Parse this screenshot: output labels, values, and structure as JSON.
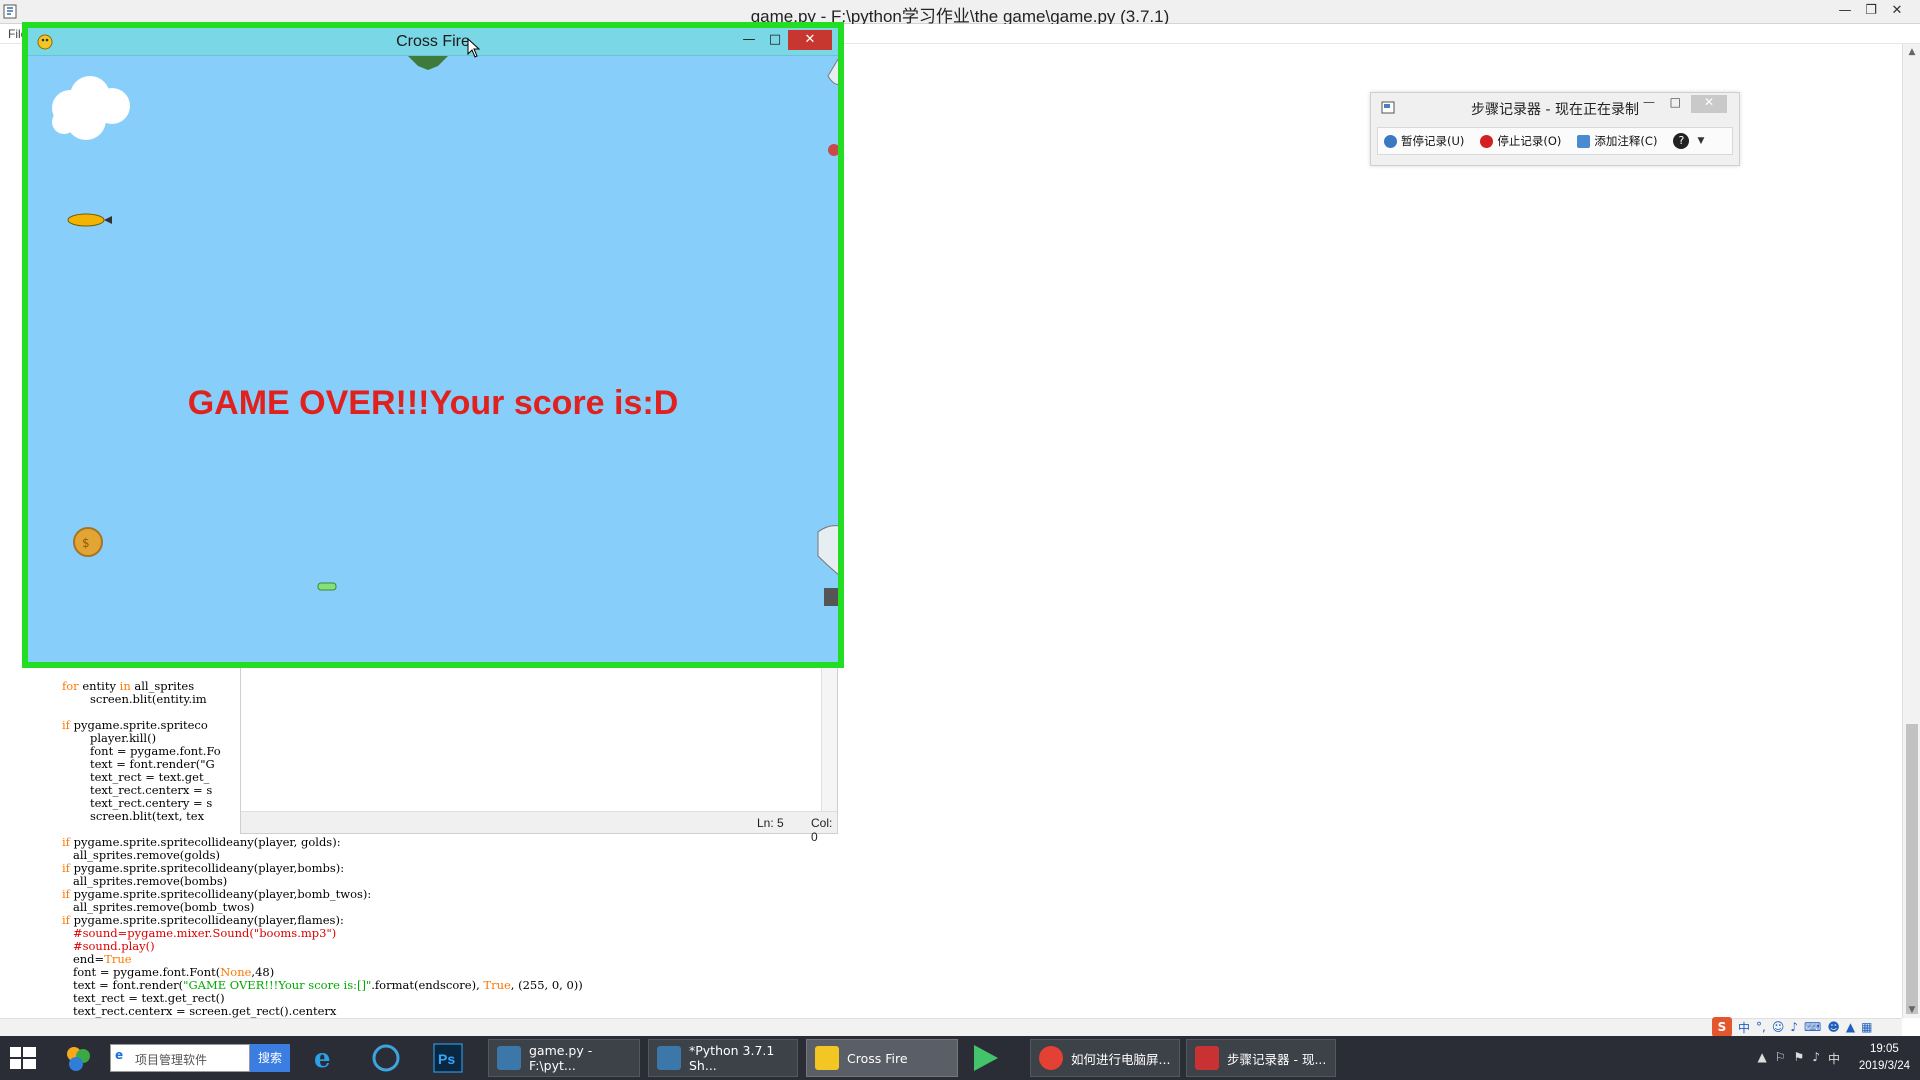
{
  "editor": {
    "title": "game.py - F:\\python学习作业\\the game\\game.py (3.7.1)",
    "menu_file": "File",
    "code_lines_partial": [
      {
        "t": "for entity in all_sprites",
        "indent": 0
      },
      {
        "t": "screen.blit(entity.im",
        "indent": 1
      },
      {
        "t": "",
        "indent": 0
      },
      {
        "t": "if pygame.sprite.spriteco",
        "indent": 0
      },
      {
        "t": "player.kill()",
        "indent": 1
      },
      {
        "t": "font = pygame.font.Fo",
        "indent": 1
      },
      {
        "t": "text = font.render(\"G",
        "indent": 1
      },
      {
        "t": "text_rect = text.get_",
        "indent": 1
      },
      {
        "t": "text_rect.centerx = s",
        "indent": 1
      },
      {
        "t": "text_rect.centery = s",
        "indent": 1
      },
      {
        "t": "screen.blit(text, tex",
        "indent": 1
      }
    ],
    "code_lines_full": [
      "if pygame.sprite.spritecollideany(player, golds):",
      "    all_sprites.remove(golds)",
      "if pygame.sprite.spritecollideany(player,bombs):",
      "    all_sprites.remove(bombs)",
      "if pygame.sprite.spritecollideany(player,bomb_twos):",
      "    all_sprites.remove(bomb_twos)",
      "if pygame.sprite.spritecollideany(player,flames):",
      "    #sound=pygame.mixer.Sound(\"booms.mp3\")",
      "    #sound.play()",
      "    end=True",
      "    font = pygame.font.Font(None,48)",
      "    text = font.render(\"GAME OVER!!!Your score is:[]\".format(endscore), True, (255, 0, 0))",
      "    text_rect = text.get_rect()",
      "    text_rect.centerx = screen.get_rect().centerx"
    ]
  },
  "shell": {
    "status_ln": "Ln: 5",
    "status_col": "Col: 0"
  },
  "game": {
    "window_title": "Cross Fire",
    "message": "GAME OVER!!!Your score is:D",
    "message_color": "#e1211d",
    "border_color": "#22dd22",
    "sky_color": "#87cefa"
  },
  "steps_recorder": {
    "title": "步骤记录器 - 现在正在录制",
    "pause": "暂停记录(U)",
    "stop": "停止记录(O)",
    "comment": "添加注释(C)"
  },
  "taskbar": {
    "search_placeholder": "项目管理软件",
    "search_button": "搜索",
    "tasks": [
      {
        "label": "game.py - F:\\pyt...",
        "icon": "python-idle-icon"
      },
      {
        "label": "*Python 3.7.1 Sh...",
        "icon": "python-shell-icon"
      },
      {
        "label": "Cross Fire",
        "icon": "pygame-icon"
      },
      {
        "label": "如何进行电脑屏...",
        "icon": "chrome-icon"
      },
      {
        "label": "步骤记录器 - 现...",
        "icon": "steps-recorder-icon"
      }
    ],
    "time": "19:05",
    "date": "2019/3/24",
    "ime": "中"
  }
}
